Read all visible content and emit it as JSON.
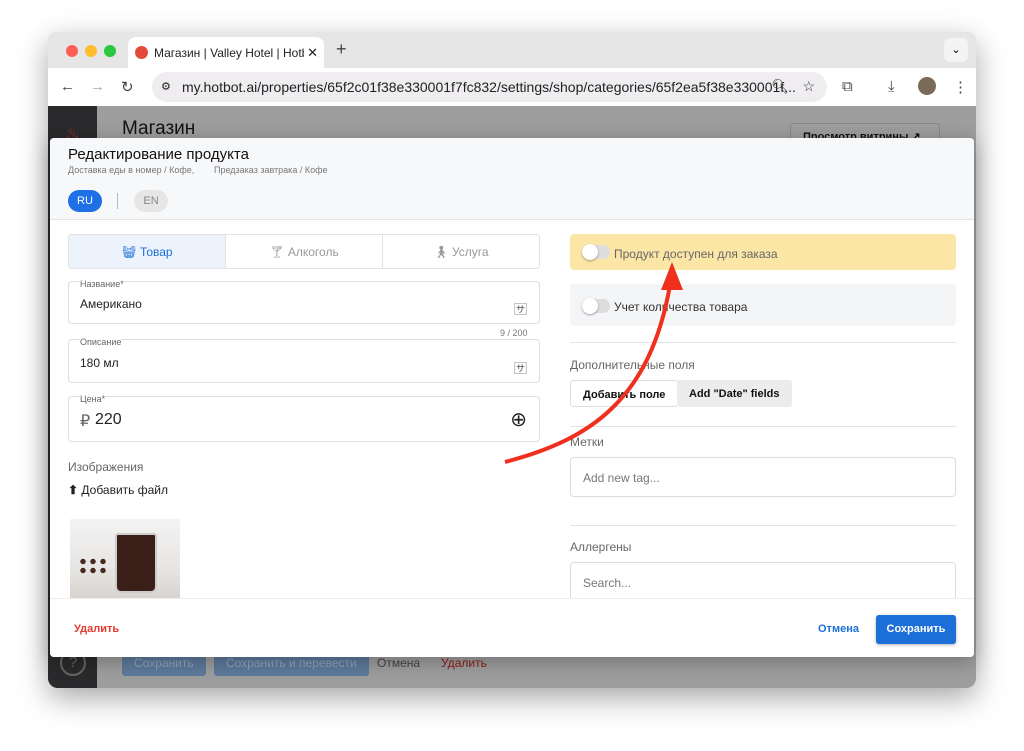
{
  "browser": {
    "tab_title": "Магазин | Valley Hotel | Hotbot",
    "url": "my.hotbot.ai/properties/65f2c01f38e330001f7fc832/settings/shop/categories/65f2ea5f38e330001f..."
  },
  "background": {
    "page_title": "Магазин",
    "storefront_button": "Просмотр витрины ↗",
    "save": "Сохранить",
    "save_translate": "Сохранить и перевести",
    "cancel": "Отмена",
    "delete": "Удалить"
  },
  "modal": {
    "title": "Редактирование продукта",
    "breadcrumbs": [
      "Доставка еды в номер / Кофе,",
      "Предзаказ завтрака / Кофе"
    ],
    "languages": [
      "RU",
      "EN"
    ],
    "tabs": [
      "Товар",
      "Алкоголь",
      "Услуга"
    ],
    "name": {
      "label": "Название*",
      "value": "Американо"
    },
    "description": {
      "label": "Описание",
      "value": "180 мл",
      "counter": "9 / 200"
    },
    "price": {
      "label": "Цена*",
      "currency": "₽",
      "value": "220"
    },
    "images_label": "Изображения",
    "add_file": "Добавить файл",
    "available_toggle": {
      "label": "Продукт доступен для заказа",
      "on": false
    },
    "stock_toggle": {
      "label": "Учет количества товара",
      "on": false
    },
    "extra_fields_label": "Дополнительные поля",
    "add_field": "Добавить поле",
    "add_date_fields": "Add \"Date\" fields",
    "tags_label": "Метки",
    "tags_placeholder": "Add new tag...",
    "allergens_label": "Аллергены",
    "allergens_placeholder": "Search...",
    "delete": "Удалить",
    "cancel": "Отмена",
    "save": "Сохранить"
  },
  "colors": {
    "primary": "#1c6fd6",
    "danger": "#e5392f",
    "highlight": "#fbe6a6",
    "arrow": "#f0301e"
  }
}
